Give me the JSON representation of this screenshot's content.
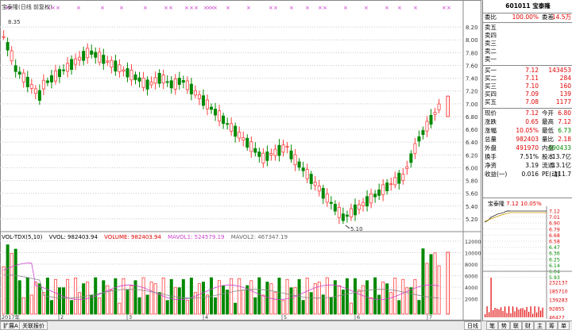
{
  "price_panel": {
    "title": "宝泰隆(日线 前复权)",
    "y_ticks": [
      "8.20",
      "8.00",
      "7.80",
      "7.60",
      "7.40",
      "7.20",
      "7.00",
      "6.80",
      "6.60",
      "6.40",
      "6.20",
      "6.00",
      "5.80",
      "5.60",
      "5.40",
      "5.20"
    ],
    "high_label": "8.35",
    "low_label": "5.10",
    "year_label": "2017年",
    "x_ticks": [
      "2",
      "3",
      "4",
      "5",
      "6",
      "7"
    ]
  },
  "volume_panel": {
    "indicator": "VOL-TDX(5,10)",
    "vvol": "VVOL: 982403.94",
    "volume": "VOLUME: 982403.94",
    "mavol1": "MAVOL1: 524579.19",
    "mavol2": "MAVOL2: 467347.19",
    "y_ticks": [
      "12000",
      "10000",
      "8000",
      "6000",
      "4000",
      "2000"
    ],
    "unit": "X100"
  },
  "colors": {
    "up": "#ff4040",
    "down": "#008800",
    "ma1": "#cc44cc",
    "ma2": "#888888",
    "grid": "#c8c8c8"
  },
  "bottom_bar": {
    "tab_expand": "扩展A",
    "tab_related": "关联报价",
    "day": "日线",
    "tab_labels": [
      "笔",
      "势",
      "联",
      "财",
      "主",
      "筹",
      "单"
    ]
  },
  "quote": {
    "code": "601011",
    "name": "宝泰隆",
    "weibi_label": "委比",
    "weibi": "100.00%",
    "weicha_label": "委差",
    "weicha": "14.5万",
    "sells": [
      {
        "label": "卖五",
        "price": "",
        "vol": ""
      },
      {
        "label": "卖四",
        "price": "",
        "vol": ""
      },
      {
        "label": "卖三",
        "price": "",
        "vol": ""
      },
      {
        "label": "卖二",
        "price": "",
        "vol": ""
      },
      {
        "label": "卖一",
        "price": "",
        "vol": ""
      }
    ],
    "buys": [
      {
        "label": "买一",
        "price": "7.12",
        "vol": "143453"
      },
      {
        "label": "买二",
        "price": "7.11",
        "vol": "284"
      },
      {
        "label": "买三",
        "price": "7.10",
        "vol": "160"
      },
      {
        "label": "买四",
        "price": "7.09",
        "vol": "139"
      },
      {
        "label": "买五",
        "price": "7.08",
        "vol": "1177"
      }
    ],
    "stats": [
      {
        "l1": "现价",
        "v1": "7.12",
        "l2": "今开",
        "v2": "6.80"
      },
      {
        "l1": "涨跌",
        "v1": "0.65",
        "l2": "最高",
        "v2": "7.12"
      },
      {
        "l1": "涨幅",
        "v1": "10.05%",
        "l2": "最低",
        "v2": "6.73"
      },
      {
        "l1": "总量",
        "v1": "982403",
        "l2": "量比",
        "v2": "2.18"
      },
      {
        "l1": "外盘",
        "v1": "491970",
        "l2": "内盘",
        "v2": "490433"
      },
      {
        "l1": "换手",
        "v1": "7.51%",
        "l2": "股本",
        "v2": "13.7亿"
      },
      {
        "l1": "净资",
        "v1": "3.19",
        "l2": "流通",
        "v2": "13.1亿"
      },
      {
        "l1": "收益(一)",
        "v1": "0.016",
        "l2": "PE(动)",
        "v2": "111.7"
      }
    ]
  },
  "mini": {
    "title": "宝泰隆",
    "price": "7.12",
    "pct": "10.05%",
    "price_ticks": [
      "7.12",
      "7.01",
      "6.90",
      "6.79",
      "6.68",
      "6.58",
      "6.47",
      "6.36",
      "6.25",
      "6.14",
      "6.04",
      "5.93"
    ],
    "vol_ticks": [
      "232137",
      "185710",
      "139283",
      "92855",
      "46427"
    ]
  }
}
